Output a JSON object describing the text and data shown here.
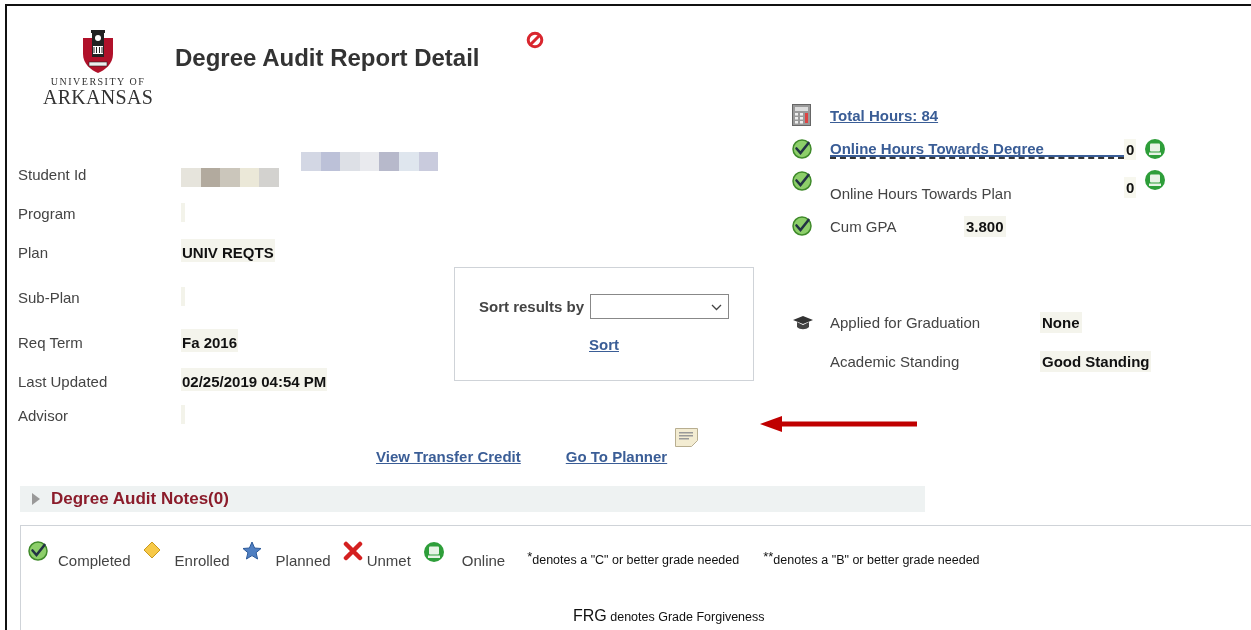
{
  "header": {
    "title": "Degree Audit Report Detail",
    "logo_line1": "UNIVERSITY OF",
    "logo_line2": "ARKANSAS"
  },
  "fields": [
    {
      "label": "Student Id",
      "kind": "redacted"
    },
    {
      "label": "Program",
      "kind": "blank"
    },
    {
      "label": "Plan",
      "kind": "text",
      "value": "UNIV REQTS"
    },
    {
      "label": "Sub-Plan",
      "kind": "blank"
    },
    {
      "label": "Req Term",
      "kind": "text",
      "value": "Fa 2016"
    },
    {
      "label": "Last Updated",
      "kind": "text",
      "value": "02/25/2019 04:54 PM"
    },
    {
      "label": "Advisor",
      "kind": "blank"
    }
  ],
  "sort": {
    "label": "Sort results by",
    "button": "Sort"
  },
  "links": [
    "View Transfer Credit",
    "Go To Planner"
  ],
  "summary": [
    {
      "kind": "link",
      "label": "Total Hours: 84"
    },
    {
      "kind": "link",
      "label": "Online Hours Towards Degree",
      "value": "0",
      "online": true
    },
    {
      "kind": "text",
      "label": "Online Hours Towards Plan",
      "value": "0",
      "online": true
    },
    {
      "kind": "text",
      "label": "Cum GPA",
      "value": "3.800",
      "online": false
    }
  ],
  "standing": [
    {
      "label": "Applied for Graduation",
      "value": "None"
    },
    {
      "label": "Academic Standing",
      "value": "Good Standing"
    }
  ],
  "notes": {
    "title": "Degree Audit Notes(0)",
    "expanded": false
  },
  "legend": {
    "items": [
      {
        "label": "Completed"
      },
      {
        "label": "Enrolled"
      },
      {
        "label": "Planned"
      },
      {
        "label": "Unmet"
      },
      {
        "label": "Online"
      }
    ],
    "footnotes": [
      {
        "mark": "*",
        "text": "denotes a \"C\" or better grade needed"
      },
      {
        "mark": "**",
        "text": "denotes a \"B\" or better grade needed"
      }
    ],
    "frg": {
      "abbr": "FRG",
      "text": "denotes Grade Forgiveness"
    }
  }
}
